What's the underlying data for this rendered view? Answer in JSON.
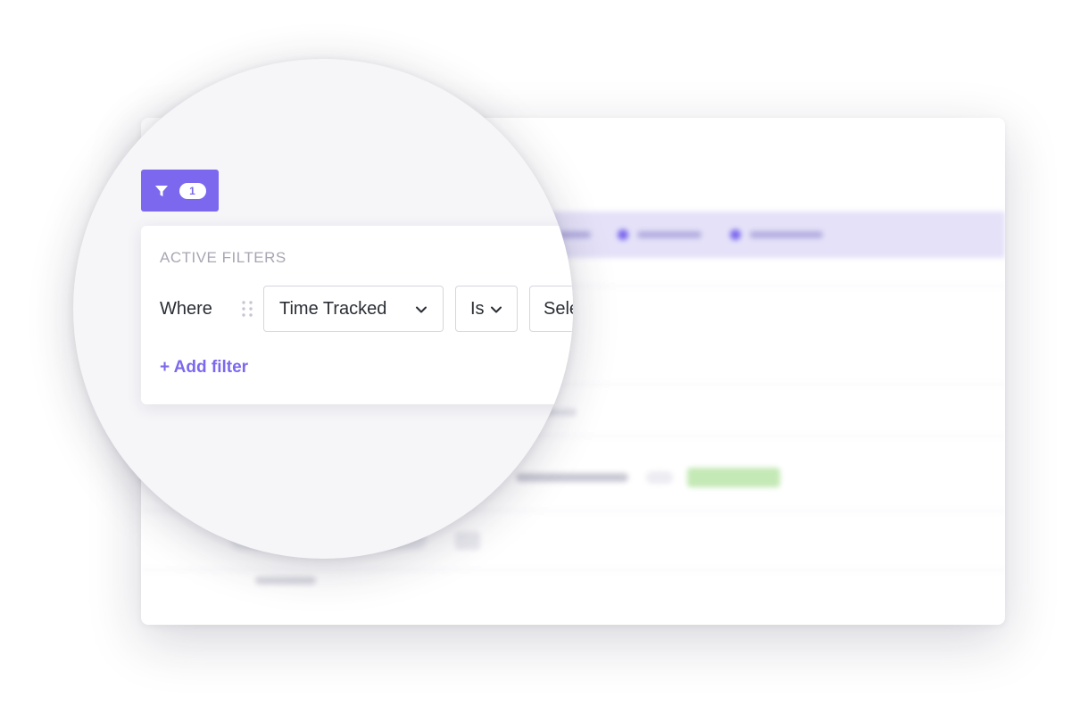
{
  "filter_button": {
    "icon": "filter-icon",
    "count": "1"
  },
  "active_filters": {
    "title": "ACTIVE FILTERS",
    "rows": [
      {
        "where_label": "Where",
        "field": "Time Tracked",
        "operator": "Is",
        "value": "Sele"
      }
    ],
    "add_filter_label": "+ Add filter"
  },
  "colors": {
    "accent": "#7b68ee",
    "header_band": "#e4e1f8",
    "badge": "#c4e9b6",
    "text": "#2a2e34",
    "muted": "#a7a7b4"
  }
}
